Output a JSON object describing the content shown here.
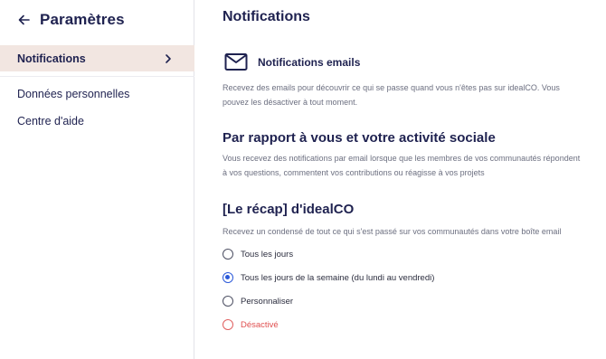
{
  "sidebar": {
    "title": "Paramètres",
    "active_item": "Notifications",
    "items": [
      {
        "label": "Données personnelles"
      },
      {
        "label": "Centre d'aide"
      }
    ]
  },
  "main": {
    "title": "Notifications",
    "email_section": {
      "label": "Notifications emails",
      "description": "Recevez des emails pour découvrir ce qui se passe quand vous n'êtes pas sur idealCO. Vous pouvez les désactiver à tout moment."
    },
    "social_section": {
      "title": "Par rapport à vous et votre activité sociale",
      "description": "Vous recevez des notifications par email lorsque que les membres de vos communautés répondent à vos questions, commentent vos contributions ou réagisse à vos projets"
    },
    "recap_section": {
      "title": "[Le récap] d'idealCO",
      "description": "Recevez un condensé de tout ce qui s'est passé sur vos communautés dans votre boîte email",
      "options": [
        {
          "label": "Tous les jours",
          "selected": false
        },
        {
          "label": "Tous les jours de la semaine (du lundi au vendredi)",
          "selected": true
        },
        {
          "label": "Personnaliser",
          "selected": false
        },
        {
          "label": "Désactivé",
          "selected": false
        }
      ]
    }
  },
  "colors": {
    "navy": "#1f2250",
    "active_bg": "#f2e6e1",
    "radio_selected": "#2b59d9",
    "danger": "#e05050"
  }
}
